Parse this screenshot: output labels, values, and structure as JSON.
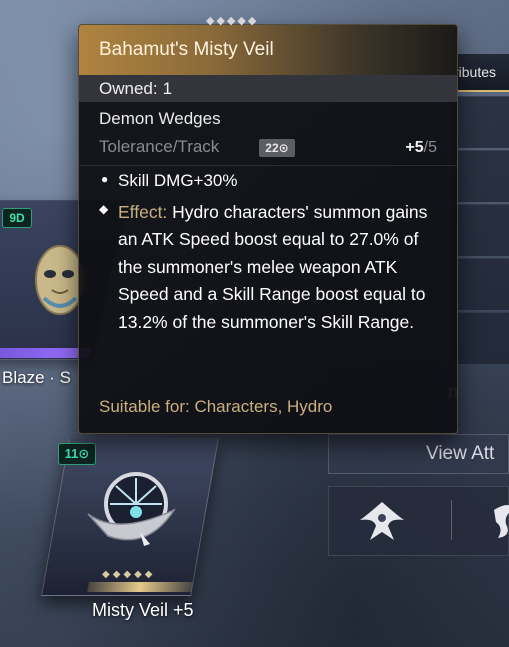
{
  "tooltip": {
    "title": "Bahamut's Misty Veil",
    "owned_label": "Owned:",
    "owned_value": "1",
    "section": "Demon Wedges",
    "tolerance_label": "Tolerance/Track",
    "tolerance_badge": "22⊙",
    "rank_current": "+5",
    "rank_max": "/5",
    "stat_line": "Skill DMG+30%",
    "effect_label": "Effect:",
    "effect_text": "Hydro characters' summon gains an ATK Speed boost equal to 27.0% of the summoner's melee weapon ATK Speed and a Skill Range boost equal to 13.2% of the summoner's Skill Range.",
    "suitable_for": "Suitable for: Characters, Hydro"
  },
  "cards": {
    "left": {
      "badge": "9D",
      "label": "Blaze · S"
    },
    "main": {
      "badge": "11⊙",
      "label": "Misty Veil +5"
    }
  },
  "right_panel": {
    "tab_partial": "ributes",
    "partial_text": "n",
    "view_button_partial": "View Att"
  },
  "icons": [
    "demon-wedge-mask-icon",
    "misty-veil-icon",
    "hydro-element-icon",
    "element-icon-partial"
  ],
  "colors": {
    "header_gold": "#b0843f",
    "effect_label_gold": "#c9b17f",
    "badge_green": "#3fe0a8",
    "tab_underline": "#d9b96c"
  }
}
